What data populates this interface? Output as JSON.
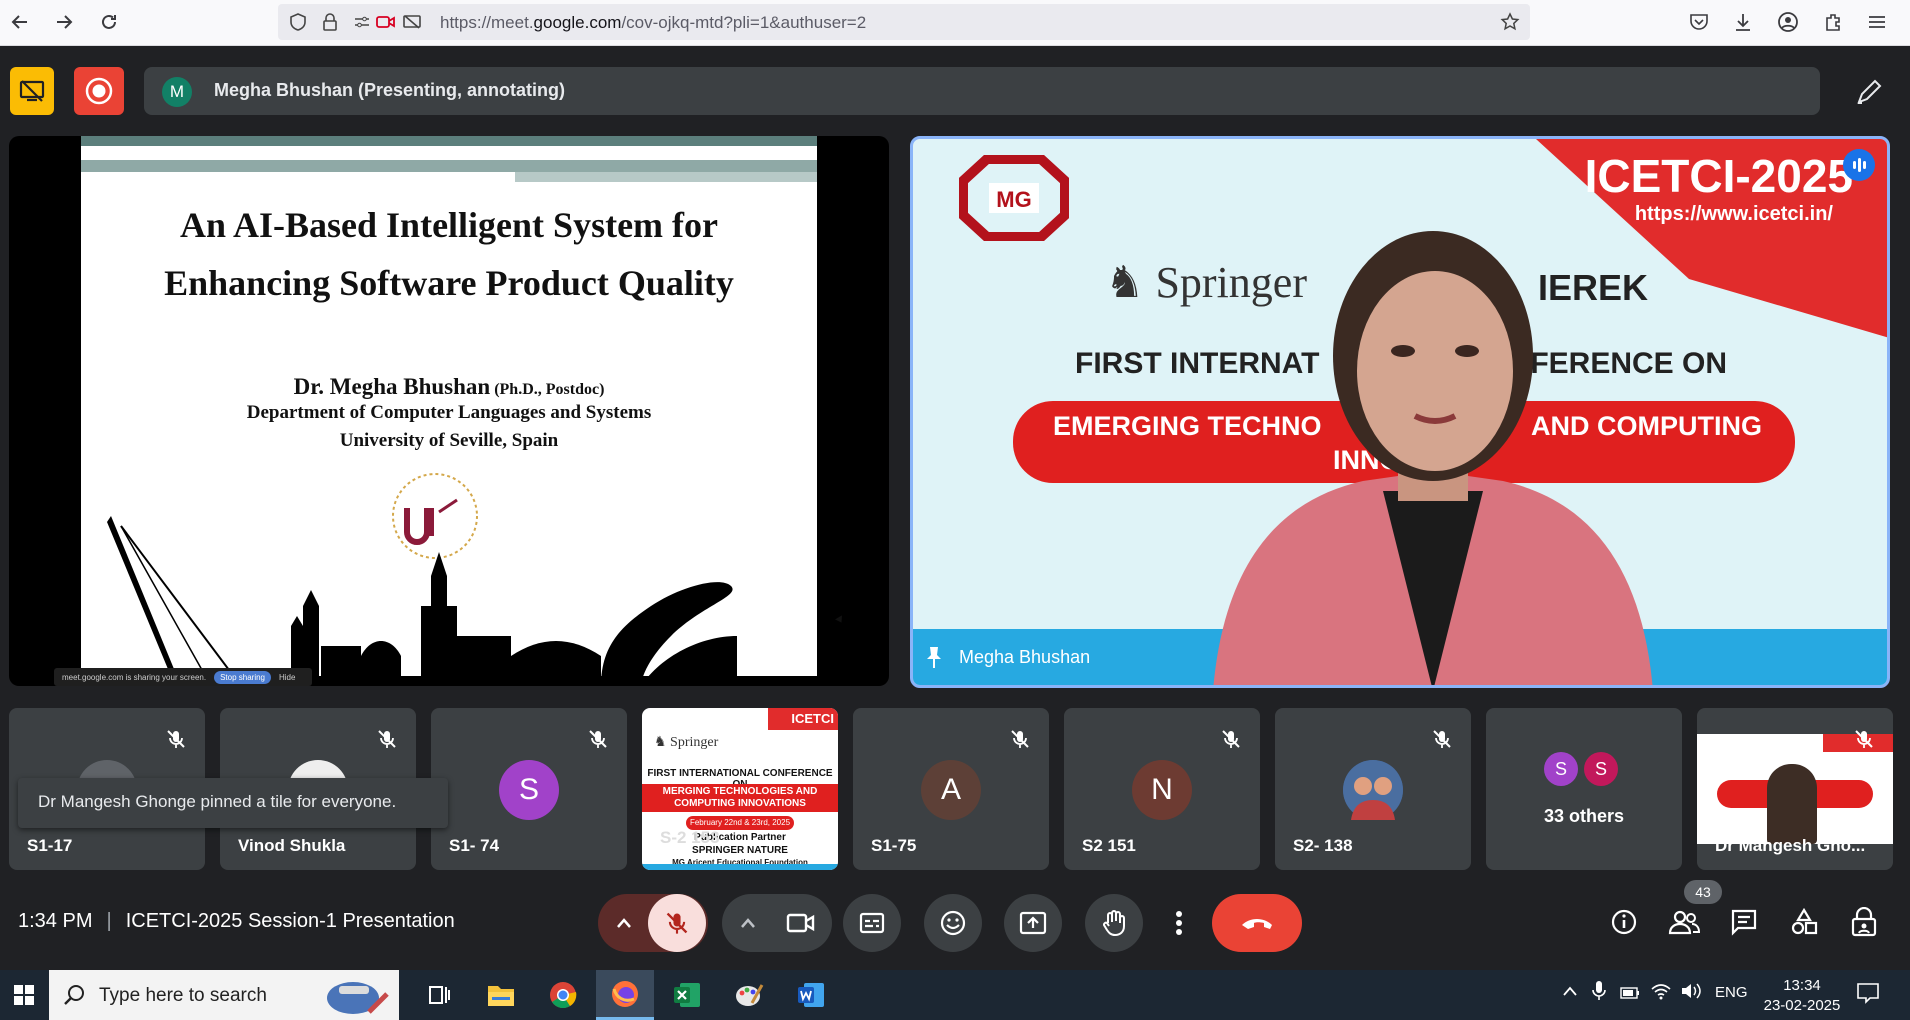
{
  "browser": {
    "url_prefix": "https://meet.",
    "url_domain": "google.com",
    "url_path": "/cov-ojkq-mtd?pli=1&authuser=2"
  },
  "meet_top": {
    "presenter_initial": "M",
    "presenter_text": "Megha Bhushan (Presenting, annotating)"
  },
  "slide": {
    "title_line1": "An AI-Based Intelligent System for",
    "title_line2": "Enhancing Software Product Quality",
    "author_name": "Dr. Megha Bhushan",
    "author_degree": "(Ph.D., Postdoc)",
    "department": "Department of Computer Languages and Systems",
    "university": "University of Seville, Spain",
    "share_notice": "meet.google.com is sharing your screen.",
    "share_stop": "Stop sharing",
    "share_hide": "Hide"
  },
  "speaker": {
    "banner_title": "ICETCI-2025",
    "banner_url": "https://www.icetci.in/",
    "springer": "Springer",
    "ierek": "IEREK",
    "conf_line_left": "FIRST INTERNAT",
    "conf_line_right": "FERENCE ON",
    "conf_red_left": "EMERGING TECHNO",
    "conf_red_right": "AND COMPUTING",
    "conf_red_line2": "INNO         S",
    "name": "Megha Bhushan"
  },
  "participants": [
    {
      "name": "S1-17",
      "initial": "",
      "color": "#5f6368"
    },
    {
      "name": "Vinod Shukla",
      "initial": "",
      "color": "#eeeeee"
    },
    {
      "name": "S1- 74",
      "initial": "S",
      "color": "#a142c9"
    },
    {
      "name": "S-2 153",
      "initial": "",
      "color": "#ffffff"
    },
    {
      "name": "S1-75",
      "initial": "A",
      "color": "#5d4037"
    },
    {
      "name": "S2 151",
      "initial": "N",
      "color": "#6d3b32"
    },
    {
      "name": "S2- 138",
      "initial": "",
      "color": "#3a5a8a"
    },
    {
      "name": "33 others",
      "initial": "",
      "color": "#3c4043"
    },
    {
      "name": "Dr Mangesh Gho...",
      "initial": "",
      "color": "#ffffff"
    }
  ],
  "others_initials": [
    "S",
    "S"
  ],
  "thumb_conf": {
    "title": "FIRST INTERNATIONAL CONFERENCE ON",
    "red": "MERGING TECHNOLOGIES AND COMPUTING INNOVATIONS",
    "dates": "February 22nd & 23rd, 2025",
    "partner": "Publication Partner",
    "springer": "SPRINGER NATURE",
    "foundation": "MG Aricent Educational Foundation",
    "icetci": "ICETCI"
  },
  "toast": "Dr Mangesh Ghonge pinned a tile for everyone.",
  "bottom": {
    "time": "1:34 PM",
    "meeting_name": "ICETCI-2025 Session-1 Presentation",
    "people_count": "43"
  },
  "taskbar": {
    "search_placeholder": "Type here to search",
    "lang": "ENG",
    "clock_time": "13:34",
    "clock_date": "23-02-2025"
  },
  "colors": {
    "meet_bg": "#202124",
    "tile_bg": "#3c4043",
    "hangup": "#ea4335",
    "present_yellow": "#fbbc04",
    "active_border": "#8ab4f8"
  }
}
